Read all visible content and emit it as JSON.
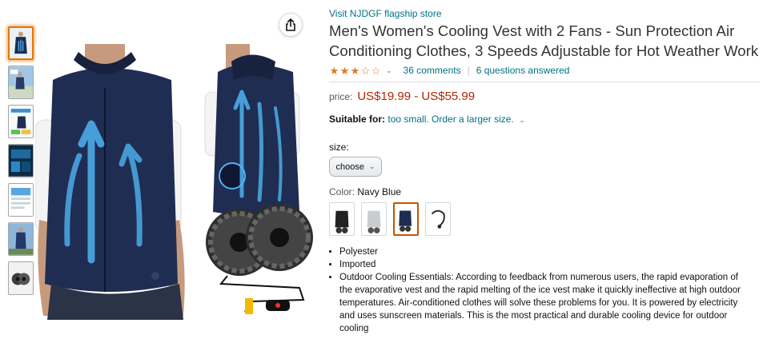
{
  "store": {
    "link_text": "Visit NJDGF flagship store"
  },
  "product": {
    "title": "Men's Women's Cooling Vest with 2 Fans - Sun Protection Air Conditioning Clothes, 3 Speeds Adjustable for Hot Weather Work",
    "rating": 3.5,
    "rating_max": 5,
    "comments_text": "36 comments",
    "questions_text": "6 questions answered",
    "price_label": "price:",
    "price_value": "US$19.99 - US$55.99",
    "suitable_label": "Suitable for:",
    "suitable_value": "too small. Order a larger size.",
    "size_label": "size:",
    "size_selected": "choose",
    "color_label": "Color:",
    "color_value": "Navy Blue",
    "bullets": [
      "Polyester",
      "Imported",
      "Outdoor Cooling Essentials: According to feedback from numerous users, the rapid evaporation of the evaporative vest and the rapid melting of the ice vest make it quickly ineffective at high outdoor temperatures. Air-conditioned clothes will solve these problems for you. It is powered by electricity and uses sunscreen materials. This is the most practical and durable cooling device for outdoor cooling"
    ]
  },
  "gallery": {
    "thumbnail_count": 7,
    "active_thumbnail": 0,
    "share_icon": "share-icon"
  },
  "swatches": [
    {
      "name": "black",
      "selected": false
    },
    {
      "name": "gray",
      "selected": false
    },
    {
      "name": "navy-blue",
      "selected": true
    },
    {
      "name": "accessory",
      "selected": false
    }
  ],
  "colors": {
    "link": "#007185",
    "price": "#b12704",
    "star": "#de7921",
    "vest_navy": "#1f2d52",
    "arrow_blue": "#4fb3f0"
  }
}
